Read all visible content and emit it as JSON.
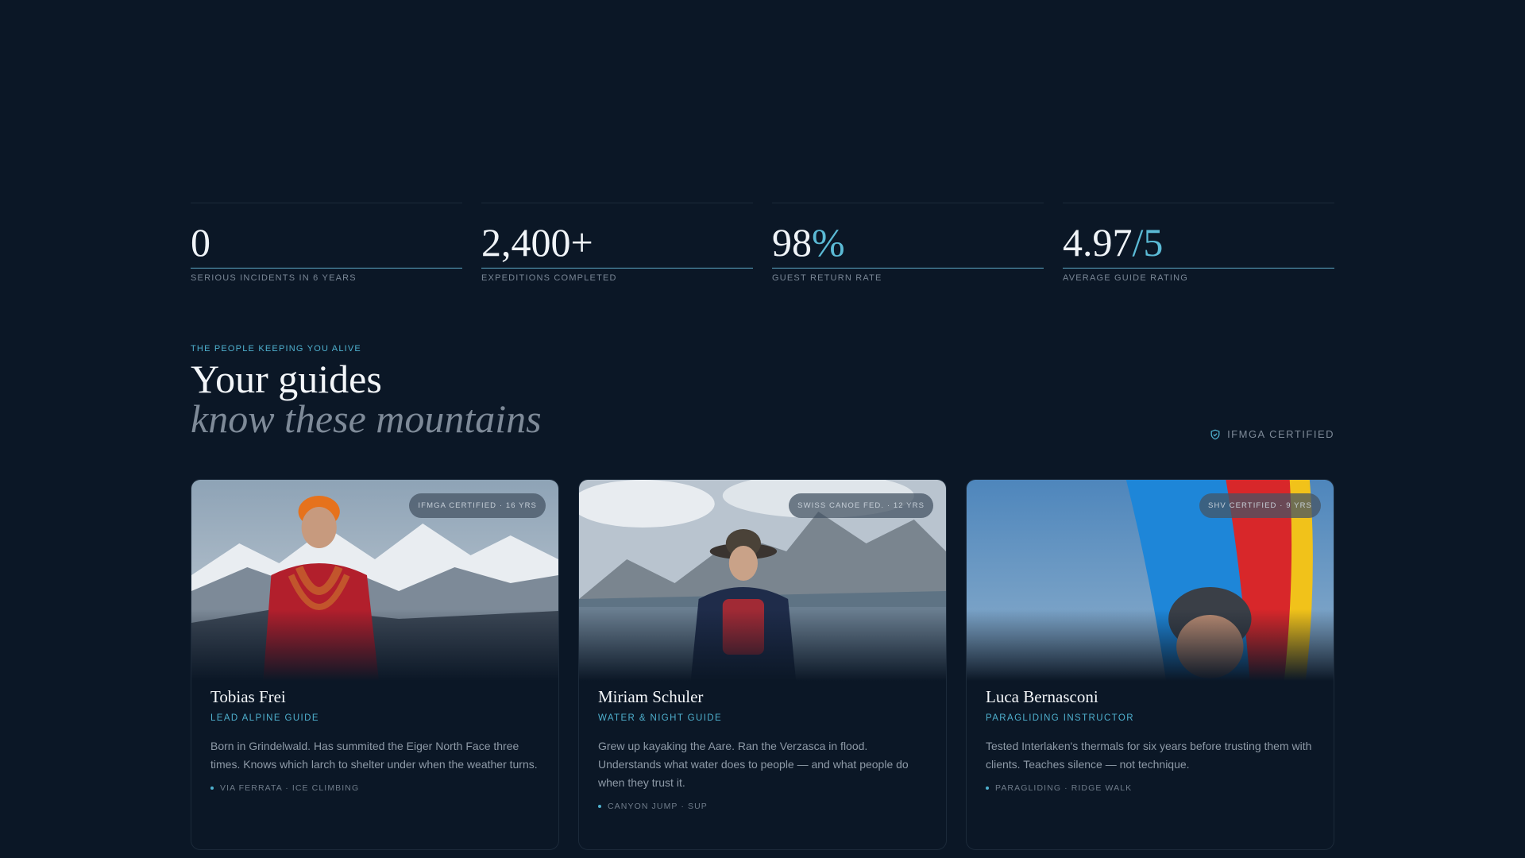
{
  "stats": [
    {
      "value": "0",
      "accent": "",
      "label": "SERIOUS INCIDENTS IN 6 YEARS"
    },
    {
      "value": "2,400+",
      "accent": "",
      "label": "EXPEDITIONS COMPLETED"
    },
    {
      "value": "98",
      "accent": "%",
      "label": "GUEST RETURN RATE"
    },
    {
      "value": "4.97",
      "accent": "/5",
      "label": "AVERAGE GUIDE RATING"
    }
  ],
  "section": {
    "eyebrow": "THE PEOPLE KEEPING YOU ALIVE",
    "title_line1": "Your guides",
    "title_line2": "know these mountains",
    "certified": "IFMGA CERTIFIED"
  },
  "guides": [
    {
      "badge": "IFMGA CERTIFIED · 16 YRS",
      "name": "Tobias Frei",
      "role": "LEAD ALPINE GUIDE",
      "bio": "Born in Grindelwald. Has summited the Eiger North Face three times. Knows which larch to shelter under when the weather turns.",
      "tags": "VIA FERRATA · ICE CLIMBING"
    },
    {
      "badge": "SWISS CANOE FED. · 12 YRS",
      "name": "Miriam Schuler",
      "role": "WATER & NIGHT GUIDE",
      "bio": "Grew up kayaking the Aare. Ran the Verzasca in flood. Understands what water does to people — and what people do when they trust it.",
      "tags": "CANYON JUMP · SUP"
    },
    {
      "badge": "SHV CERTIFIED · 9 YRS",
      "name": "Luca Bernasconi",
      "role": "PARAGLIDING INSTRUCTOR",
      "bio": "Tested Interlaken's thermals for six years before trusting them with clients. Teaches silence — not technique.",
      "tags": "PARAGLIDING · RIDGE WALK"
    }
  ],
  "icons": {
    "certified": "shield-check-icon"
  },
  "colors": {
    "background": "#0b1726",
    "accent": "#4fb1cf",
    "muted": "#7e8a98"
  }
}
